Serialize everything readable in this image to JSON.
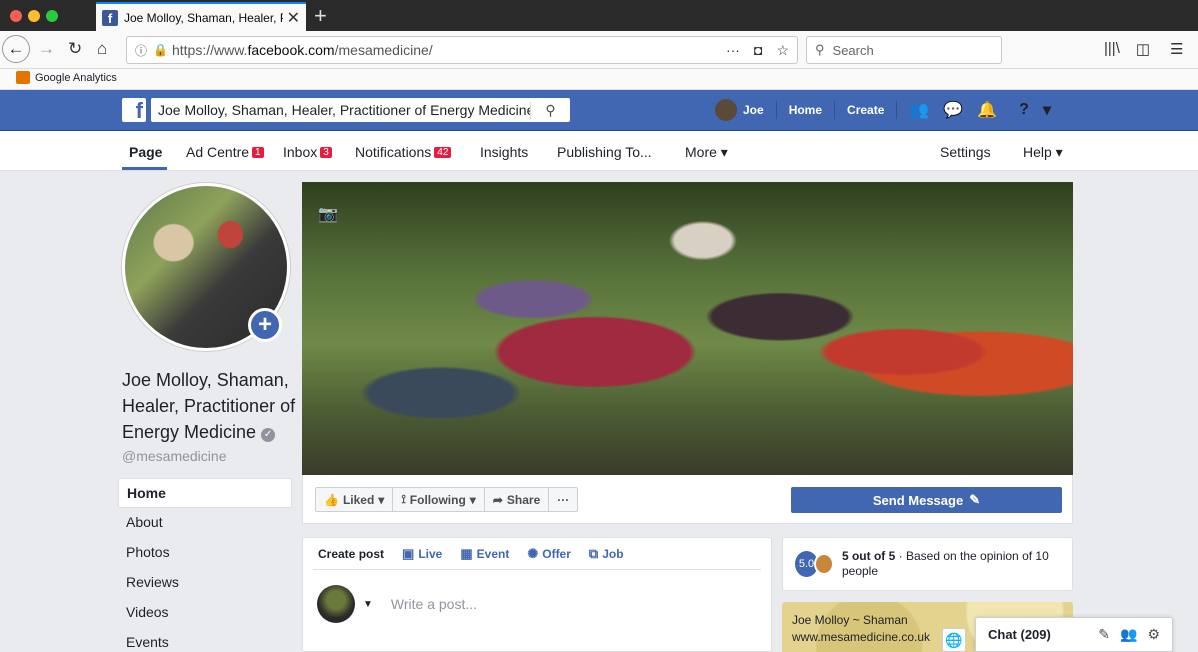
{
  "browser": {
    "tab_title": "Joe Molloy, Shaman, Healer, Pr",
    "url_prefix": "https://www.",
    "url_domain": "facebook.com",
    "url_path": "/mesamedicine/",
    "search_placeholder": "Search",
    "bookmark": "Google Analytics"
  },
  "fb": {
    "search_value": "Joe Molloy, Shaman, Healer, Practitioner of Energy Medicine",
    "user": "Joe",
    "home": "Home",
    "create": "Create"
  },
  "page_nav": {
    "page": "Page",
    "ad_centre": "Ad Centre",
    "ad_centre_badge": "1",
    "inbox": "Inbox",
    "inbox_badge": "3",
    "notifications": "Notifications",
    "notifications_badge": "42",
    "insights": "Insights",
    "publishing": "Publishing To...",
    "more": "More ▾",
    "settings": "Settings",
    "help": "Help ▾"
  },
  "profile": {
    "name": "Joe Molloy, Shaman, Healer, Practitioner of Energy Medicine",
    "handle": "@mesamedicine"
  },
  "side_nav": [
    "Home",
    "About",
    "Photos",
    "Reviews",
    "Videos",
    "Events"
  ],
  "actions": {
    "liked": "Liked",
    "following": "Following",
    "share": "Share",
    "more": "···",
    "send_message": "Send Message"
  },
  "composer": {
    "create_post": "Create post",
    "live": "Live",
    "event": "Event",
    "offer": "Offer",
    "job": "Job",
    "placeholder": "Write a post..."
  },
  "rating": {
    "score": "5.0",
    "headline": "5 out of 5",
    "detail": " · Based on the opinion of 10 people"
  },
  "map": {
    "line1": "Joe Molloy ~ Shaman",
    "line2": "www.mesamedicine.co.uk"
  },
  "chat": {
    "label": "Chat (209)"
  }
}
